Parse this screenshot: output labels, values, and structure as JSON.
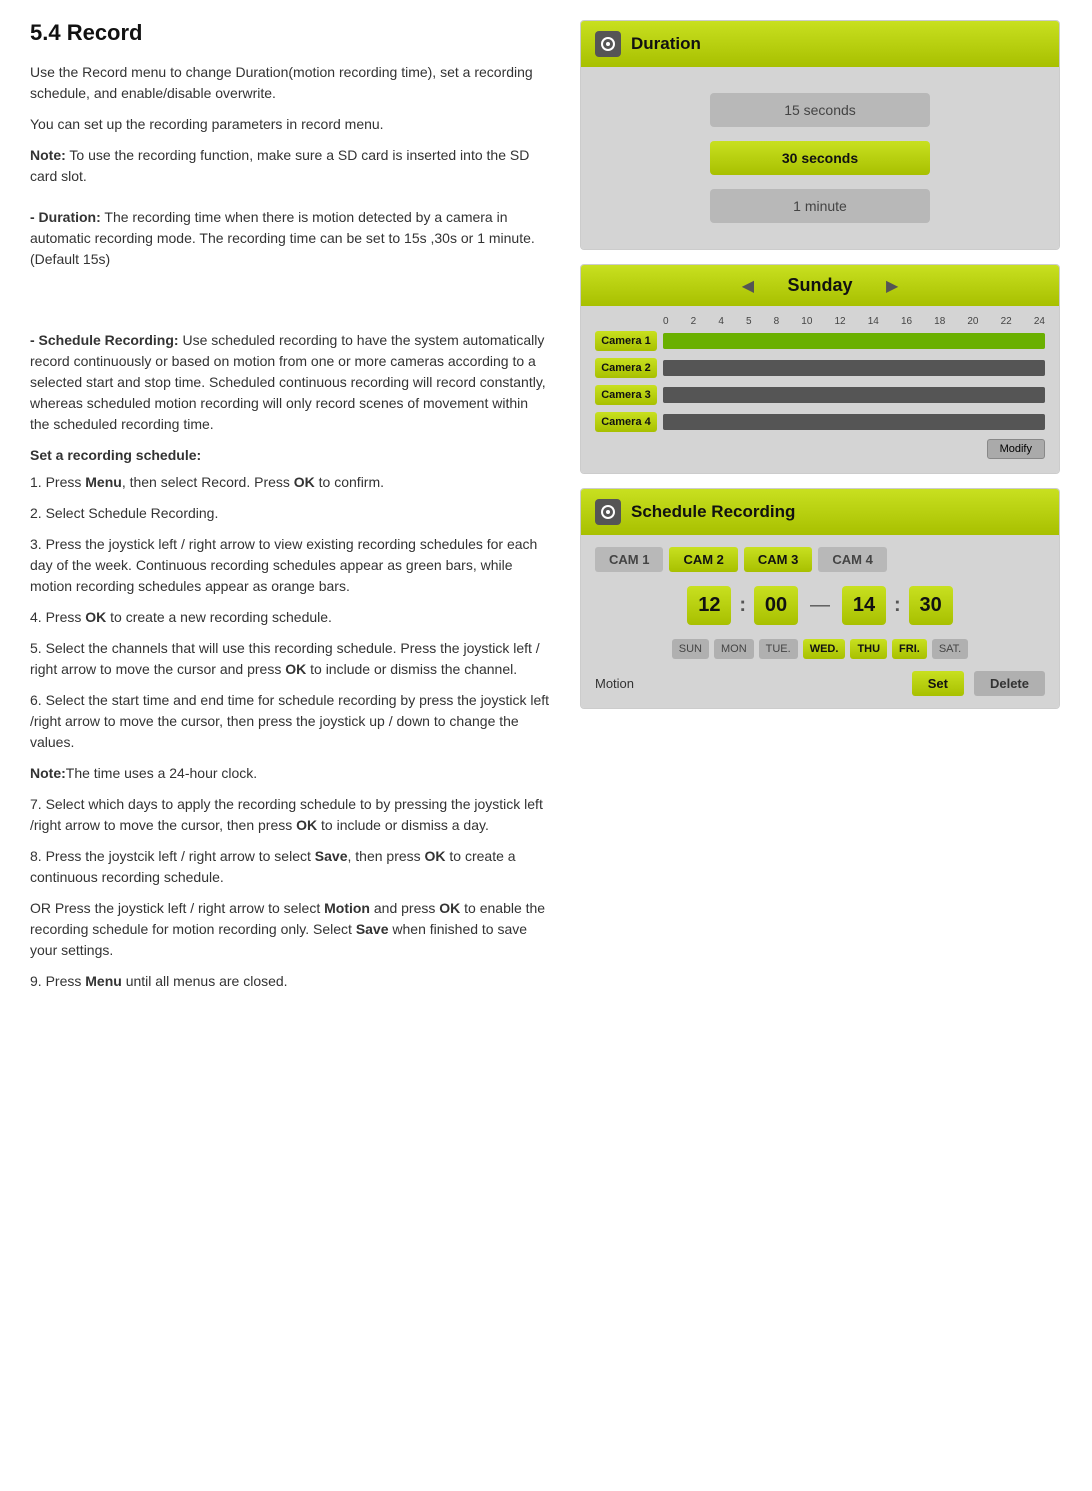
{
  "page": {
    "title": "5.4   Record",
    "intro1": "Use the Record menu to change Duration(motion recording time), set a recording schedule, and enable/disable overwrite.",
    "intro2": "You can set up the recording parameters in record menu.",
    "note": "Note: To use the recording function, make sure a SD card is inserted into the SD card slot.",
    "duration_desc": "- Duration: The recording time when there is motion detected by a camera in automatic recording mode. The recording time can be set to 15s ,30s or 1 minute.(Default 15s)",
    "schedule_desc": "- Schedule Recording: Use scheduled recording to have the system automatically record continuously or based on motion from one or more cameras according to a selected start and stop time. Scheduled continuous recording will record constantly, whereas scheduled motion recording will only record scenes of movement within the scheduled recording time.",
    "set_schedule_heading": "Set a recording schedule:",
    "steps": [
      "1. Press Menu, then select Record. Press OK to confirm.",
      "2. Select Schedule Recording.",
      "3. Press the joystick left / right arrow to view existing recording schedules for each day of the week. Continuous recording schedules appear as green bars, while motion recording schedules appear as orange bars.",
      "4. Press OK to create a new recording schedule.",
      "5. Select the channels that will use this recording schedule. Press the joystick left / right arrow to move the cursor and press OK to include or dismiss the channel.",
      "6. Select the start time and end time for schedule recording by press the joystick left /right arrow to move the cursor, then press the joystick up / down to change the values.",
      "Note:The time uses a 24-hour clock.",
      "7. Select which days to apply the recording schedule to by pressing the joystick left /right arrow to move the cursor, then press OK to include or dismiss a day.",
      "8. Press the joystcik left / right arrow to select Save, then press OK to create a continuous recording schedule.",
      "OR Press the joystick left / right arrow to select Motion and press OK to enable the recording schedule for motion recording only. Select Save when finished to save your settings.",
      "9. Press Menu until all menus are closed."
    ],
    "step_1_bold": "Menu",
    "step_1_bold2": "OK",
    "step_4_bold": "OK",
    "step_5_bold1": "OK",
    "step_7_bold": "OK",
    "step_8_bold1": "Save",
    "step_8_bold2": "OK",
    "step_8_bold3": "Motion",
    "step_8_bold4": "OK",
    "step_8_bold5": "Save",
    "step_9_bold": "Menu"
  },
  "duration_panel": {
    "header": "Duration",
    "icon": "●",
    "options": [
      {
        "label": "15 seconds",
        "active": false
      },
      {
        "label": "30 seconds",
        "active": true
      },
      {
        "label": "1 minute",
        "active": false
      }
    ]
  },
  "schedule_day_panel": {
    "day": "Sunday",
    "hours": [
      "0",
      "2",
      "4",
      "5",
      "8",
      "10",
      "12",
      "14",
      "16",
      "18",
      "20",
      "22",
      "24"
    ],
    "cameras": [
      {
        "label": "Camera 1",
        "fill_start": 0,
        "fill_width": 100,
        "fill_type": "green"
      },
      {
        "label": "Camera 2",
        "fill_start": 0,
        "fill_width": 100,
        "fill_type": "dark"
      },
      {
        "label": "Camera 3",
        "fill_start": 0,
        "fill_width": 100,
        "fill_type": "dark"
      },
      {
        "label": "Camera 4",
        "fill_start": 0,
        "fill_width": 100,
        "fill_type": "dark"
      }
    ],
    "modify_label": "Modify"
  },
  "schedule_rec_panel": {
    "header": "Schedule Recording",
    "icon": "●",
    "cam_tabs": [
      {
        "label": "CAM 1",
        "active": false
      },
      {
        "label": "CAM 2",
        "active": true
      },
      {
        "label": "CAM 3",
        "active": true
      },
      {
        "label": "CAM 4",
        "active": false
      }
    ],
    "start_hour": "12",
    "start_min": "00",
    "end_hour": "14",
    "end_min": "30",
    "days": [
      {
        "label": "SUN",
        "active": false
      },
      {
        "label": "MON",
        "active": false
      },
      {
        "label": "TUE.",
        "active": false
      },
      {
        "label": "WED.",
        "active": true
      },
      {
        "label": "THU",
        "active": true
      },
      {
        "label": "FRI.",
        "active": true
      },
      {
        "label": "SAT.",
        "active": false
      }
    ],
    "motion_label": "Motion",
    "set_label": "Set",
    "delete_label": "Delete"
  }
}
